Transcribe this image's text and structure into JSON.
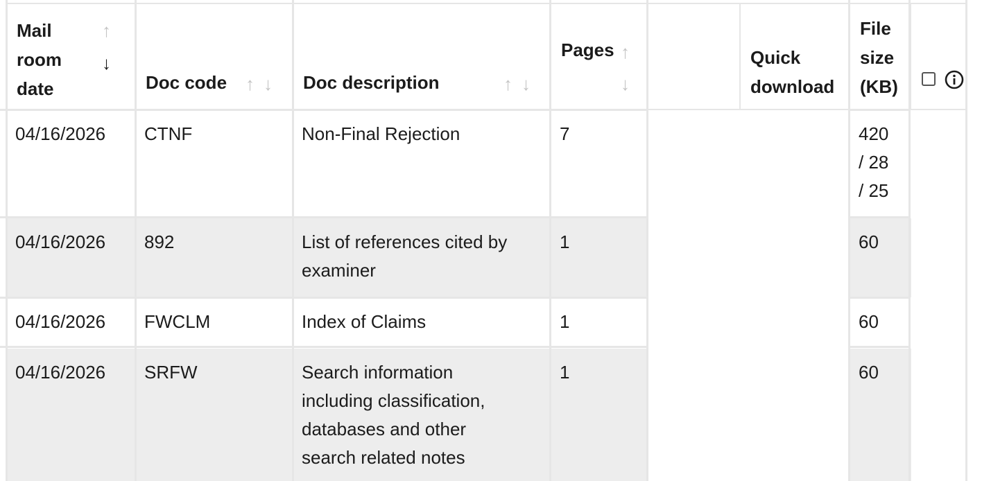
{
  "table": {
    "headers": {
      "mail_room_date": [
        "Mail",
        "room",
        "date"
      ],
      "doc_code": "Doc code",
      "doc_description": "Doc description",
      "pages": "Pages",
      "quick_download": [
        "Quick",
        "download"
      ],
      "file_size": [
        "File",
        "size",
        "(KB)"
      ]
    },
    "sort_arrows": {
      "up": "↑",
      "down": "↓"
    },
    "rows": [
      {
        "mail_room_date": "04/16/2026",
        "doc_code": "CTNF",
        "doc_description": [
          "Non-Final Rejection"
        ],
        "pages": "7",
        "file_size": [
          "420",
          "/ 28",
          "/ 25"
        ],
        "shade": "white"
      },
      {
        "mail_room_date": "04/16/2026",
        "doc_code": "892",
        "doc_description": [
          "List of references cited by",
          "examiner"
        ],
        "pages": "1",
        "file_size": [
          "60"
        ],
        "shade": "gray"
      },
      {
        "mail_room_date": "04/16/2026",
        "doc_code": "FWCLM",
        "doc_description": [
          "Index of Claims"
        ],
        "pages": "1",
        "file_size": [
          "60"
        ],
        "shade": "white"
      },
      {
        "mail_room_date": "04/16/2026",
        "doc_code": "SRFW",
        "doc_description": [
          "Search information",
          "including classification,",
          "databases and other",
          "search related notes"
        ],
        "pages": "1",
        "file_size": [
          "60"
        ],
        "shade": "gray"
      }
    ]
  },
  "icons": {
    "select_all": "checkbox-icon",
    "info": "info-icon"
  },
  "colors": {
    "row_gray": "#ededed",
    "border": "#e6e6e6",
    "arrow_dim": "#c3c3c3",
    "text": "#1b1b1b"
  }
}
